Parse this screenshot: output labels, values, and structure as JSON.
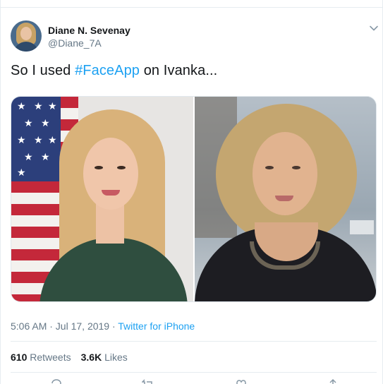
{
  "author": {
    "display_name": "Diane N. Sevenay",
    "handle": "@Diane_7A"
  },
  "tweet": {
    "text_before": "So I used ",
    "hashtag": "#FaceApp",
    "text_after": " on Ivanka..."
  },
  "media": {
    "left_image": "portrait-photo",
    "right_image": "portrait-photo"
  },
  "meta": {
    "time_date": "5:06 AM · Jul 17, 2019 · ",
    "source": "Twitter for iPhone"
  },
  "stats": {
    "retweets_count": "610",
    "retweets_label": " Retweets",
    "likes_count": "3.6K",
    "likes_label": " Likes"
  },
  "icons": [
    "chevron-down-icon",
    "reply-icon",
    "retweet-icon",
    "like-icon",
    "share-icon"
  ],
  "colors": {
    "link": "#1da1f2",
    "secondary_text": "#657786",
    "primary_text": "#14171a",
    "divider": "#e6ecf0"
  }
}
